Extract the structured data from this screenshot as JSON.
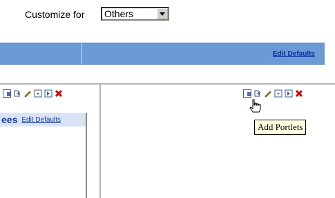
{
  "customize": {
    "label": "Customize for",
    "selected": "Others"
  },
  "header_bar": {
    "edit_defaults": "Edit Defaults"
  },
  "left_portlet": {
    "title_fragment": "ees",
    "edit_defaults": "Edit Defaults",
    "toolbar_icons": [
      "add-portlets-icon",
      "move-icon",
      "edit-icon",
      "minimize-icon",
      "maximize-icon",
      "close-icon"
    ]
  },
  "right_portlet": {
    "toolbar_icons": [
      "add-portlets-icon",
      "move-icon",
      "edit-icon",
      "minimize-icon",
      "maximize-icon",
      "close-icon"
    ]
  },
  "tooltip": {
    "text": "Add Portlets"
  },
  "colors": {
    "blue_bar": "#6a9bd6",
    "link": "#0a2ea0",
    "tooltip_bg": "#ffffe1",
    "close_red": "#cc0000"
  }
}
